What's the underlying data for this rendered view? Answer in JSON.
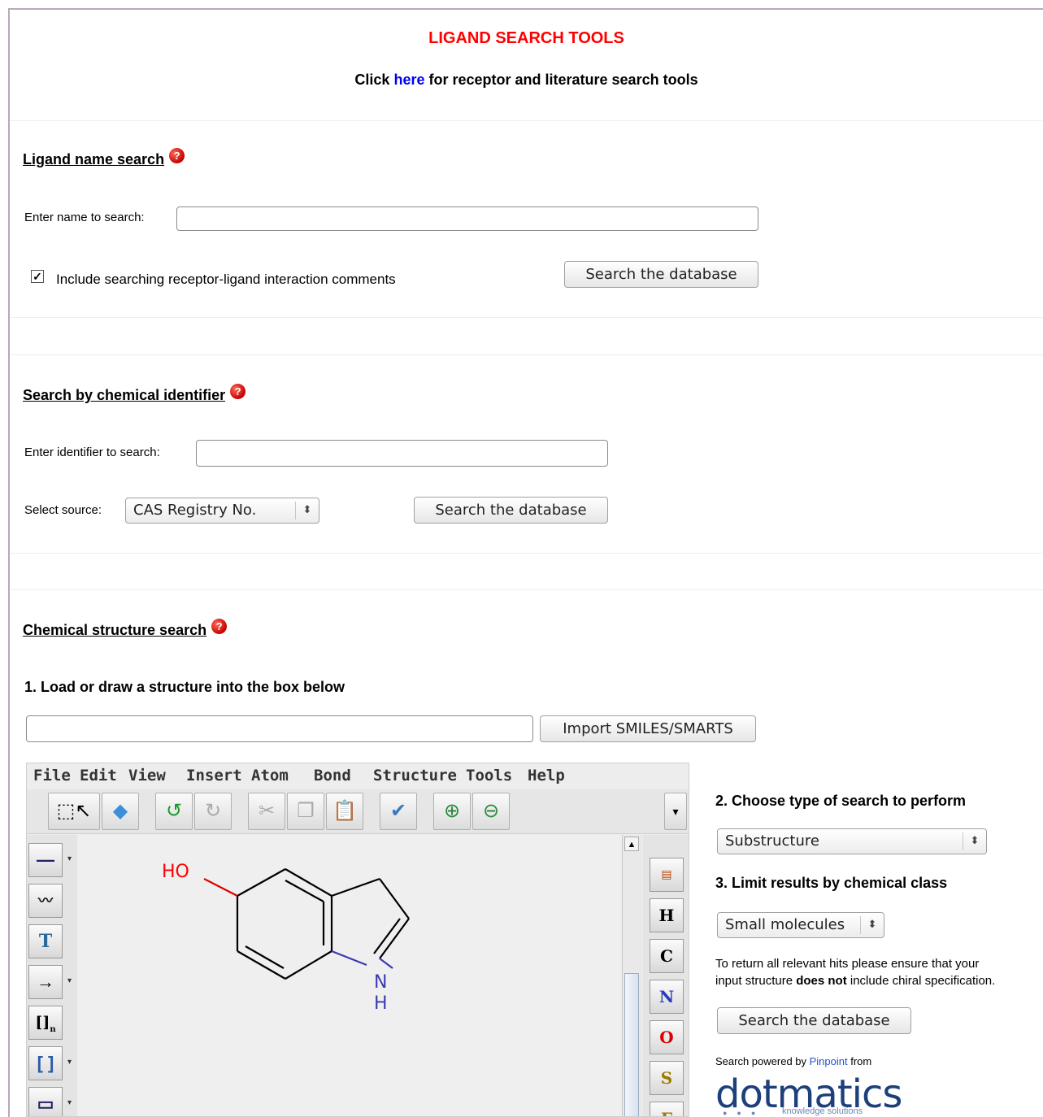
{
  "header": {
    "title": "LIGAND SEARCH TOOLS",
    "sub_prefix": "Click ",
    "sub_link": "here",
    "sub_suffix": " for receptor and literature search tools"
  },
  "name_search": {
    "heading": "Ligand name search",
    "help": "?",
    "label": "Enter name to search:",
    "value": "",
    "checkbox_checked": true,
    "checkbox_label": "Include searching receptor-ligand interaction comments",
    "button": "Search the database"
  },
  "identifier_search": {
    "heading": "Search by chemical identifier",
    "help": "?",
    "label": "Enter identifier to search:",
    "value": "",
    "source_label": "Select source:",
    "source_value": "CAS Registry No.",
    "button": "Search the database"
  },
  "structure_search": {
    "heading": "Chemical structure search",
    "help": "?",
    "step1": "1. Load or draw a structure into the box below",
    "smiles_value": "",
    "import_button": "Import SMILES/SMARTS",
    "step2": "2. Choose type of search to perform",
    "search_type": "Substructure",
    "step3": "3. Limit results by chemical class",
    "chem_class": "Small molecules",
    "note_1": "To return all relevant hits please ensure that your",
    "note_2_pre": "input structure ",
    "note_2_bold": "does not",
    "note_2_post": " include chiral specification.",
    "button": "Search the database",
    "powered_pre": "Search powered by ",
    "powered_link": "Pinpoint",
    "powered_post": " from",
    "logo_text": "dotmatics",
    "logo_tagline": "knowledge solutions"
  },
  "editor": {
    "menu": [
      "File",
      "Edit",
      "View",
      "Insert",
      "Atom",
      "Bond",
      "Structure",
      "Tools",
      "Help"
    ],
    "atoms": [
      "H",
      "C",
      "N",
      "O",
      "S",
      "F"
    ],
    "mol_ho": "HO",
    "mol_n": "N",
    "mol_h": "H",
    "left_tool_T": "T",
    "left_tool_brackets": "[]",
    "left_tool_n": "n"
  },
  "colors": {
    "title": "#ff0000",
    "link": "#0000ee",
    "oxygen": "#ff0000",
    "nitrogen": "#3333cc"
  }
}
